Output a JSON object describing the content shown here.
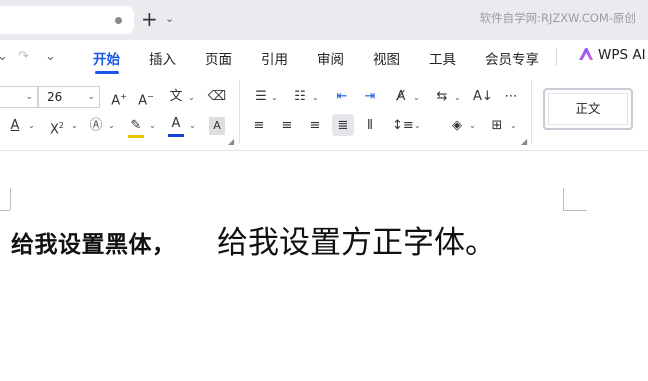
{
  "titlebar": {
    "watermark": "软件自学网:RJZXW.COM-原创",
    "new_tab_symbol": "+",
    "new_tab_chevron": "⌄"
  },
  "quick_access": {
    "redo_symbol": "↷",
    "more_symbol": "⌄"
  },
  "menu": {
    "items": [
      "开始",
      "插入",
      "页面",
      "引用",
      "审阅",
      "视图",
      "工具",
      "会员专享"
    ],
    "active_index": 0,
    "ai_label": "WPS AI",
    "accent_color": "#1a56ea"
  },
  "ribbon": {
    "font_size": "26",
    "style_name": "正文",
    "icons": [
      "font-grow-icon",
      "font-shrink-icon",
      "phonetic-guide-icon",
      "clear-format-icon",
      "underline-icon",
      "superscript-icon",
      "text-effect-icon",
      "highlight-icon",
      "font-color-icon",
      "char-shading-icon",
      "bullets-icon",
      "numbering-icon",
      "decrease-indent-icon",
      "increase-indent-icon",
      "text-direction-icon",
      "line-break-icon",
      "sort-icon",
      "show-marks-icon",
      "align-left-icon",
      "align-center-icon",
      "align-right-icon",
      "justify-icon",
      "distributed-icon",
      "line-spacing-icon",
      "shading-icon",
      "border-icon"
    ],
    "font_color_bar": "#1a3fd6",
    "highlight_color_bar": "#e8c100"
  },
  "document": {
    "line1": "给我设置黑体，",
    "line2": "给我设置方正字体。"
  }
}
